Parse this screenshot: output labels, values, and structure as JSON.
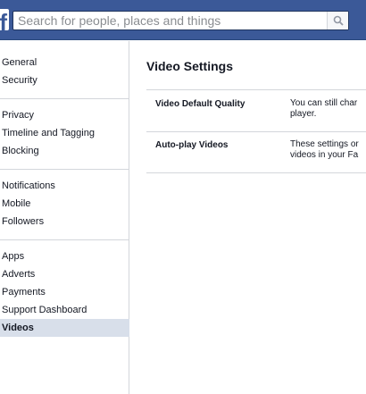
{
  "search": {
    "placeholder": "Search for people, places and things"
  },
  "sidebar": {
    "groups": [
      [
        "General",
        "Security"
      ],
      [
        "Privacy",
        "Timeline and Tagging",
        "Blocking"
      ],
      [
        "Notifications",
        "Mobile",
        "Followers"
      ],
      [
        "Apps",
        "Adverts",
        "Payments",
        "Support Dashboard",
        "Videos"
      ]
    ],
    "active": "Videos"
  },
  "main": {
    "title": "Video Settings",
    "rows": [
      {
        "label": "Video Default Quality",
        "desc_line1": "You can still char",
        "desc_line2": "player."
      },
      {
        "label": "Auto-play Videos",
        "desc_line1": "These settings or",
        "desc_line2": "videos in your Fa"
      }
    ]
  },
  "colors": {
    "topbar": "#3b5998",
    "active_item_bg": "#d8dfea",
    "divider": "#d3d6db"
  },
  "icons": {
    "logo": "facebook-logo",
    "search": "search-icon"
  }
}
